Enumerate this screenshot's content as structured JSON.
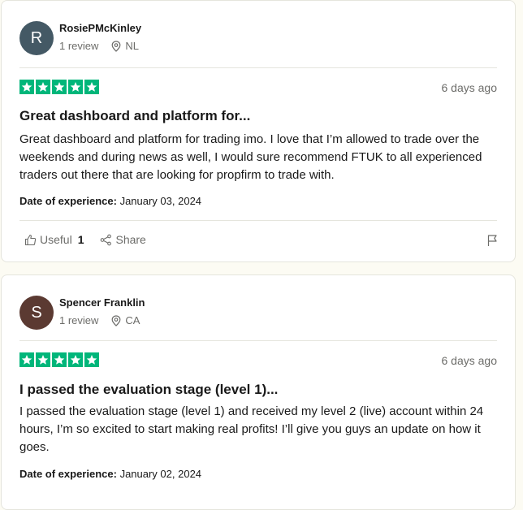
{
  "reviews": [
    {
      "initial": "R",
      "avatar_color": "#445965",
      "name": "RosiePMcKinley",
      "review_count": "1 review",
      "country": "NL",
      "rating": 5,
      "date": "6 days ago",
      "title": "Great dashboard and platform for...",
      "body": "Great dashboard and platform for trading imo. I love that I’m allowed to trade over the weekends and during news as well, I would sure recommend FTUK to all experienced traders out there that are looking for propfirm to trade with.",
      "experience_label": "Date of experience:",
      "experience_date": "January 03, 2024",
      "useful_label": "Useful",
      "useful_count": "1",
      "share_label": "Share"
    },
    {
      "initial": "S",
      "avatar_color": "#5b3a32",
      "name": "Spencer Franklin",
      "review_count": "1 review",
      "country": "CA",
      "rating": 5,
      "date": "6 days ago",
      "title": "I passed the evaluation stage (level 1)...",
      "body": "I passed the evaluation stage (level 1) and received my level 2 (live) account within 24 hours, I’m so excited to start making real profits! I’ll give you guys an update on how it goes.",
      "experience_label": "Date of experience:",
      "experience_date": "January 02, 2024"
    }
  ],
  "colors": {
    "star_green": "#00b67a",
    "muted_text": "#6c6c69",
    "page_bg": "#fcfbf3"
  }
}
